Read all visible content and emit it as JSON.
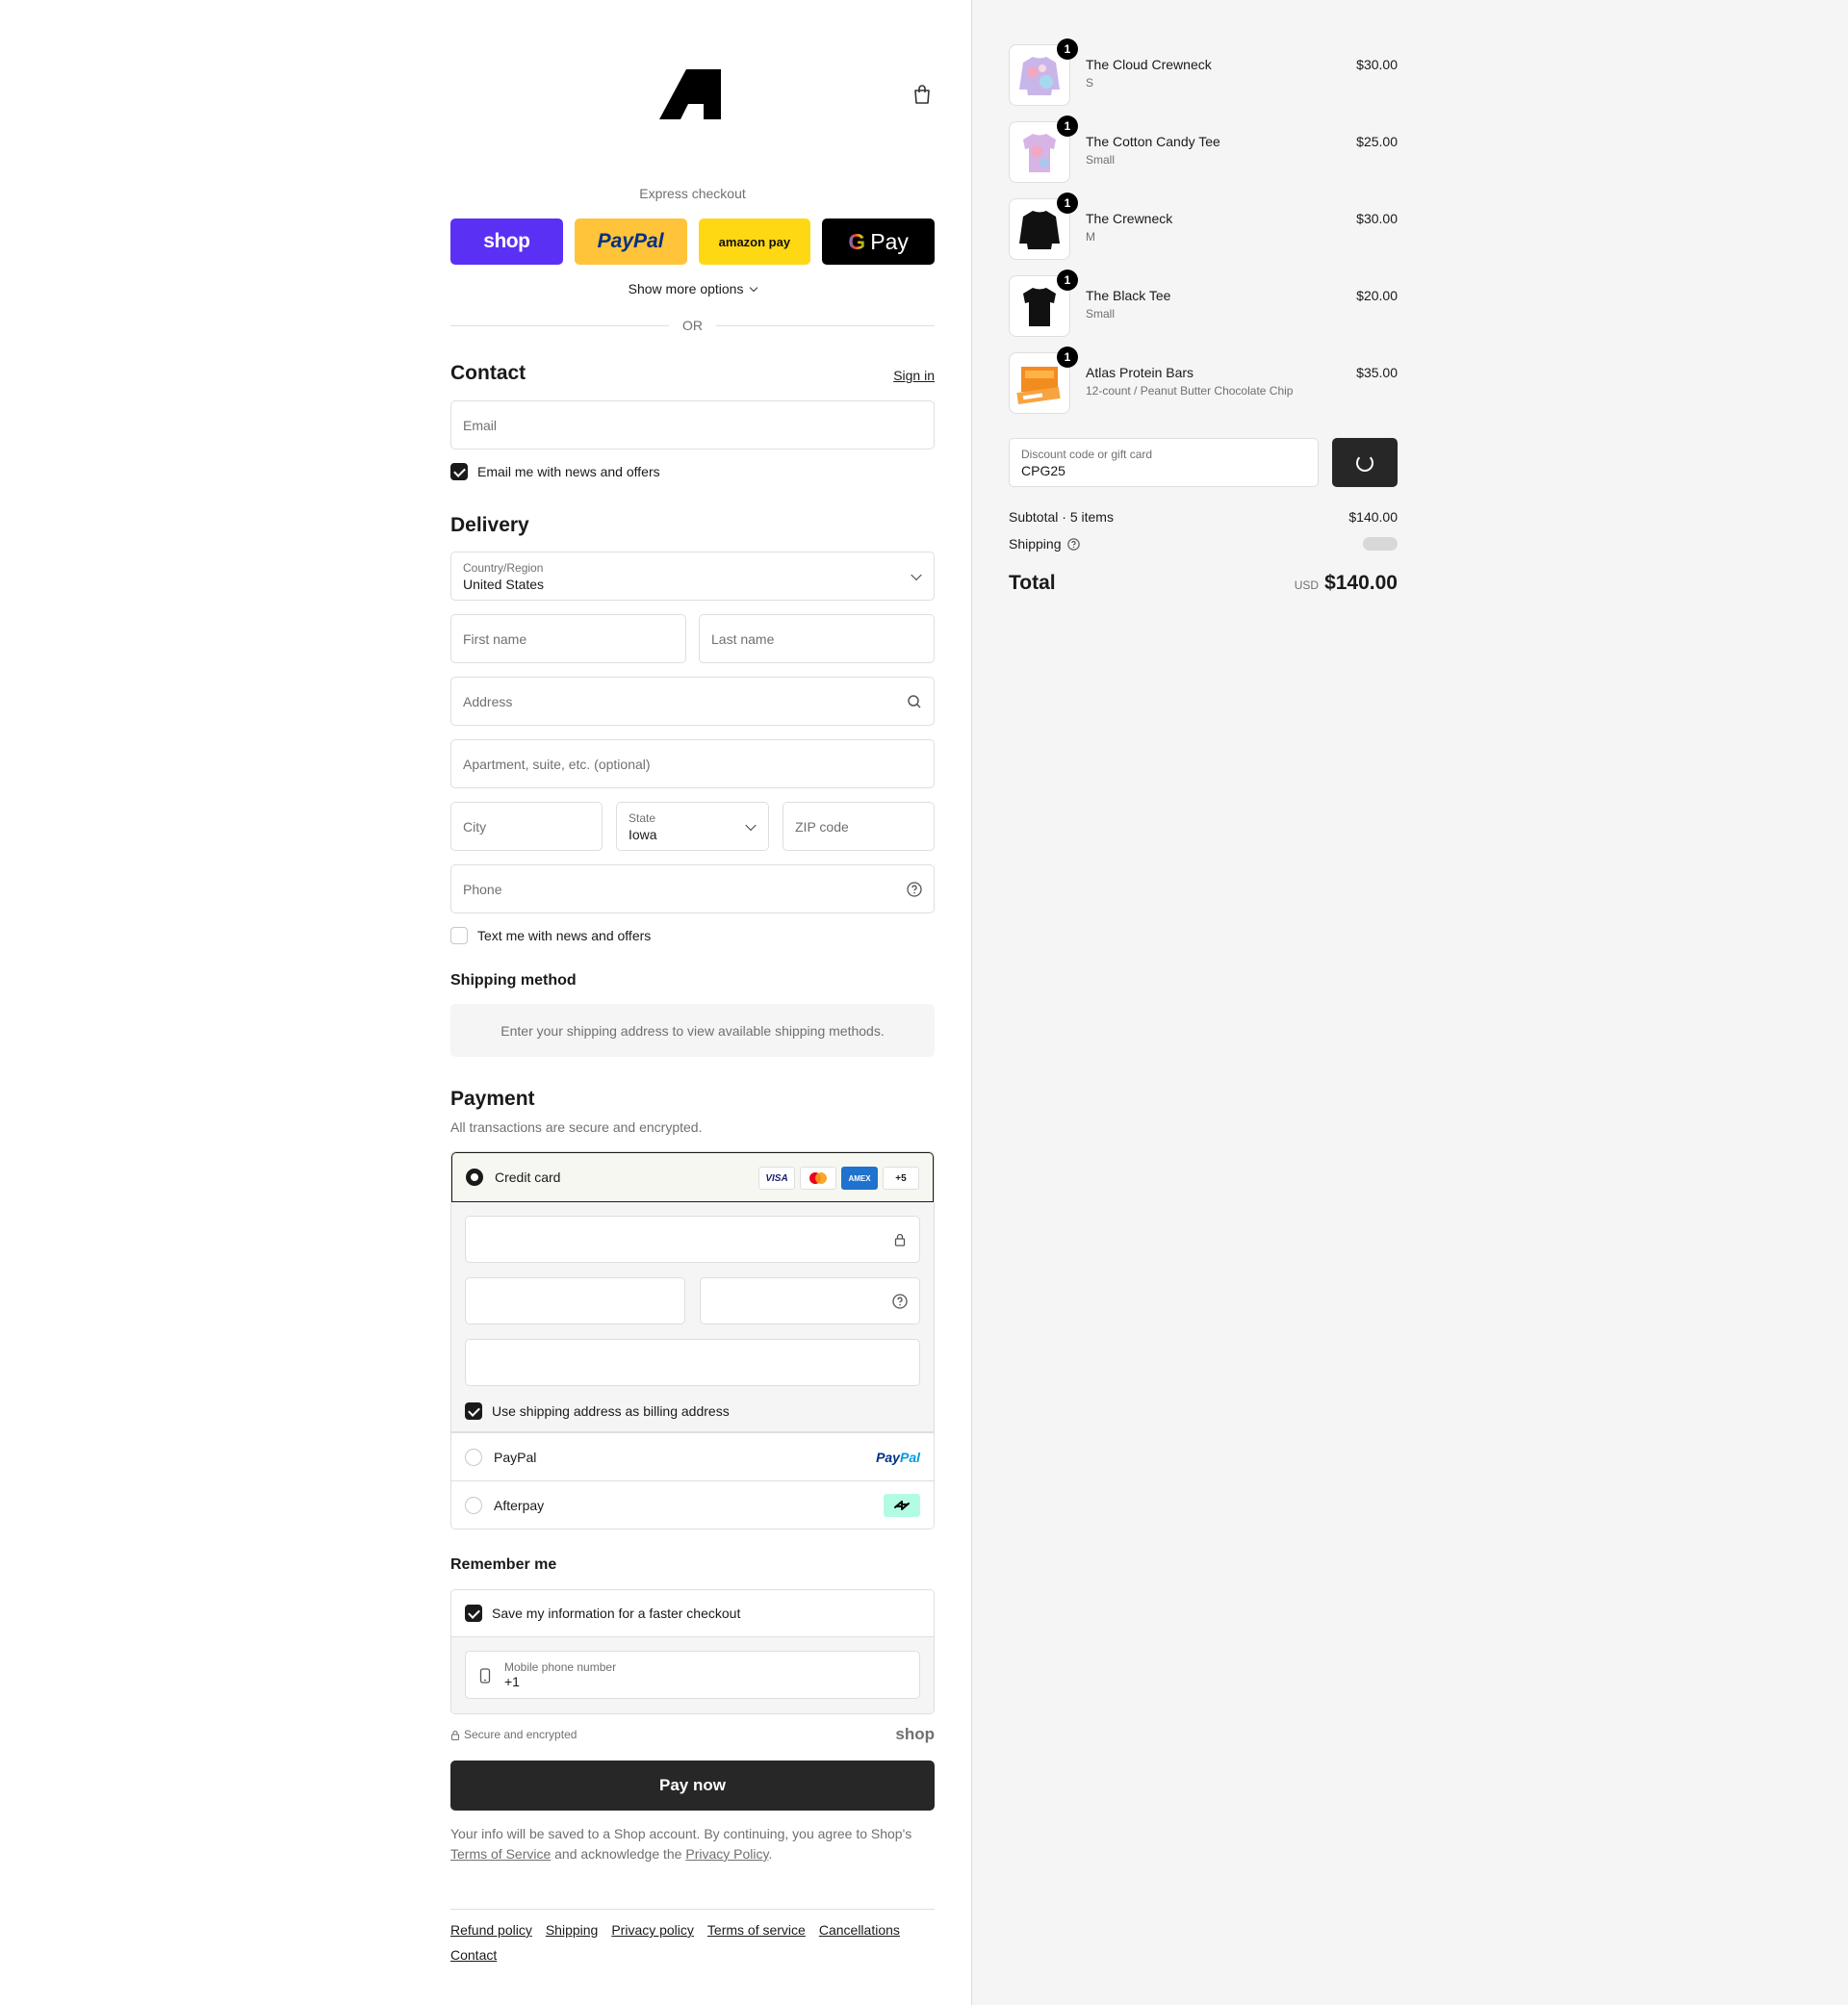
{
  "header": {
    "logo_icon": "atlas-logo",
    "cart_icon": "shopping-bag-icon"
  },
  "express": {
    "title": "Express checkout",
    "buttons": [
      "shop",
      "PayPal",
      "amazon pay",
      "Pay"
    ],
    "show_more": "Show more options",
    "or": "OR"
  },
  "contact": {
    "title": "Contact",
    "sign_in": "Sign in",
    "email_placeholder": "Email",
    "news_label": "Email me with news and offers",
    "news_checked": true
  },
  "delivery": {
    "title": "Delivery",
    "country_label": "Country/Region",
    "country_value": "United States",
    "first_name": "First name",
    "last_name": "Last name",
    "address": "Address",
    "apartment": "Apartment, suite, etc. (optional)",
    "city": "City",
    "state_label": "State",
    "state_value": "Iowa",
    "zip": "ZIP code",
    "phone": "Phone",
    "text_label": "Text me with news and offers",
    "text_checked": false
  },
  "shipping_method": {
    "title": "Shipping method",
    "notice": "Enter your shipping address to view available shipping methods."
  },
  "payment": {
    "title": "Payment",
    "subtitle": "All transactions are secure and encrypted.",
    "credit_card": "Credit card",
    "card_brands": [
      "VISA",
      "MC",
      "AMEX",
      "+5"
    ],
    "billing_label": "Use shipping address as billing address",
    "billing_checked": true,
    "paypal": "PayPal",
    "paypal_logo_a": "Pay",
    "paypal_logo_b": "Pal",
    "afterpay": "Afterpay"
  },
  "remember": {
    "title": "Remember me",
    "save_label": "Save my information for a faster checkout",
    "save_checked": true,
    "phone_label": "Mobile phone number",
    "phone_value": "+1"
  },
  "secure": {
    "text": "Secure and encrypted",
    "brand": "shop"
  },
  "pay_now": "Pay now",
  "legal": {
    "pre": "Your info will be saved to a Shop account. By continuing, you agree to Shop's ",
    "tos": "Terms of Service",
    "mid": " and acknowledge the ",
    "privacy": "Privacy Policy",
    "post": "."
  },
  "footer": [
    "Refund policy",
    "Shipping",
    "Privacy policy",
    "Terms of service",
    "Cancellations",
    "Contact"
  ],
  "cart": {
    "items": [
      {
        "name": "The Cloud Crewneck",
        "variant": "S",
        "price": "$30.00",
        "qty": "1"
      },
      {
        "name": "The Cotton Candy Tee",
        "variant": "Small",
        "price": "$25.00",
        "qty": "1"
      },
      {
        "name": "The Crewneck",
        "variant": "M",
        "price": "$30.00",
        "qty": "1"
      },
      {
        "name": "The Black Tee",
        "variant": "Small",
        "price": "$20.00",
        "qty": "1"
      },
      {
        "name": "Atlas Protein Bars",
        "variant": "12-count / Peanut Butter Chocolate Chip",
        "price": "$35.00",
        "qty": "1"
      }
    ],
    "discount_label": "Discount code or gift card",
    "discount_value": "CPG25",
    "subtotal_label": "Subtotal · 5 items",
    "subtotal_value": "$140.00",
    "shipping_label": "Shipping",
    "total_label": "Total",
    "currency": "USD",
    "total_value": "$140.00"
  }
}
